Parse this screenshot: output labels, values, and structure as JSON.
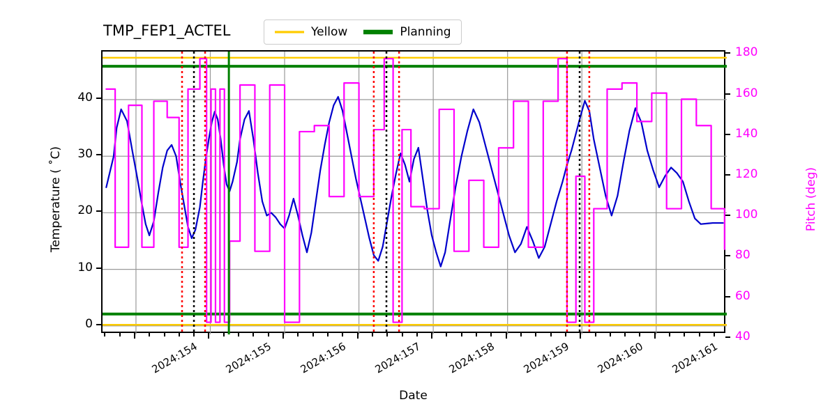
{
  "chart_data": {
    "type": "line",
    "title": "TMP_FEP1_ACTEL",
    "xlabel": "Date",
    "ylabel": "Temperature ( ˚C)",
    "y2label": "Pitch (deg)",
    "grid": true,
    "legend_position": "upper center",
    "xlim": [
      153.55,
      161.95
    ],
    "x_tick_labels": [
      "2024:154",
      "2024:155",
      "2024:156",
      "2024:157",
      "2024:158",
      "2024:159",
      "2024:160",
      "2024:161"
    ],
    "x_tick_values": [
      154,
      155,
      156,
      157,
      158,
      159,
      160,
      161
    ],
    "x_minor_per_major": 5,
    "ylim": [
      -1.5,
      48.5
    ],
    "y_ticks": [
      0,
      10,
      20,
      30,
      40
    ],
    "y2lim": [
      42.0,
      181.5
    ],
    "y2_ticks": [
      40,
      60,
      80,
      100,
      120,
      140,
      160,
      180
    ],
    "legend": [
      {
        "name": "Yellow",
        "color": "#FFCC00",
        "linewidth": 2
      },
      {
        "name": "Planning",
        "color": "#008000",
        "linewidth": 4
      }
    ],
    "series": [
      {
        "name": "Temperature",
        "color": "#0000CC",
        "axis": "left",
        "linewidth": 2.2,
        "x": [
          153.6,
          153.7,
          153.74,
          153.8,
          153.88,
          153.95,
          154.02,
          154.08,
          154.13,
          154.18,
          154.24,
          154.3,
          154.36,
          154.42,
          154.48,
          154.54,
          154.6,
          154.66,
          154.7,
          154.75,
          154.8,
          154.86,
          154.9,
          154.94,
          154.98,
          155.02,
          155.06,
          155.1,
          155.14,
          155.18,
          155.22,
          155.26,
          155.3,
          155.36,
          155.4,
          155.46,
          155.52,
          155.58,
          155.64,
          155.7,
          155.76,
          155.82,
          155.88,
          155.94,
          156.0,
          156.06,
          156.12,
          156.18,
          156.24,
          156.3,
          156.36,
          156.42,
          156.48,
          156.54,
          156.6,
          156.66,
          156.72,
          156.78,
          156.84,
          156.9,
          156.96,
          157.02,
          157.08,
          157.14,
          157.2,
          157.26,
          157.32,
          157.38,
          157.44,
          157.5,
          157.56,
          157.62,
          157.68,
          157.74,
          157.8,
          157.86,
          157.92,
          157.98,
          158.04,
          158.1,
          158.16,
          158.22,
          158.3,
          158.38,
          158.46,
          158.54,
          158.62,
          158.7,
          158.78,
          158.86,
          158.94,
          159.02,
          159.1,
          159.18,
          159.26,
          159.34,
          159.42,
          159.5,
          159.58,
          159.66,
          159.74,
          159.8,
          159.86,
          159.92,
          159.98,
          160.04,
          160.1,
          160.16,
          160.24,
          160.32,
          160.4,
          160.48,
          160.56,
          160.64,
          160.72,
          160.8,
          160.88,
          160.96,
          161.04,
          161.12,
          161.2,
          161.28,
          161.36,
          161.44,
          161.52,
          161.6,
          161.68,
          161.76,
          161.84,
          161.9
        ],
        "y": [
          24.5,
          30.0,
          35.0,
          38.3,
          36.2,
          31.0,
          26.0,
          21.5,
          18.0,
          16.0,
          18.5,
          23.5,
          28.0,
          31.0,
          32.0,
          30.0,
          25.0,
          20.5,
          17.5,
          15.5,
          17.0,
          21.0,
          25.5,
          29.5,
          33.0,
          36.0,
          37.9,
          36.5,
          33.0,
          28.5,
          25.0,
          23.8,
          25.5,
          29.0,
          33.0,
          36.5,
          38.0,
          33.0,
          27.0,
          22.0,
          19.5,
          20.0,
          19.2,
          18.0,
          17.2,
          19.5,
          22.5,
          19.5,
          16.0,
          13.0,
          16.5,
          22.0,
          27.5,
          32.0,
          36.0,
          39.0,
          40.5,
          38.0,
          34.0,
          30.0,
          26.0,
          22.5,
          19.0,
          15.5,
          12.5,
          11.5,
          14.0,
          18.5,
          23.0,
          27.0,
          30.5,
          28.5,
          25.5,
          29.5,
          31.5,
          26.0,
          20.5,
          16.0,
          13.0,
          10.5,
          13.0,
          18.0,
          24.5,
          30.0,
          34.5,
          38.3,
          36.0,
          32.0,
          28.0,
          24.0,
          20.0,
          16.0,
          13.0,
          14.5,
          17.5,
          15.0,
          12.0,
          14.0,
          18.0,
          22.0,
          25.5,
          28.5,
          31.0,
          34.0,
          37.0,
          39.8,
          38.0,
          33.0,
          28.0,
          23.0,
          19.5,
          23.0,
          29.0,
          34.5,
          38.5,
          36.0,
          31.0,
          27.5,
          24.5,
          26.5,
          28.0,
          27.0,
          25.5,
          22.0,
          19.0,
          18.0,
          18.1,
          18.2,
          18.2,
          18.2
        ]
      },
      {
        "name": "Pitch",
        "color": "#FF00FF",
        "axis": "right",
        "linewidth": 2.2,
        "drawstyle": "steps-post",
        "x": [
          153.6,
          153.66,
          153.72,
          153.8,
          153.9,
          154.0,
          154.08,
          154.16,
          154.24,
          154.33,
          154.42,
          154.5,
          154.58,
          154.64,
          154.7,
          154.78,
          154.86,
          154.92,
          154.95,
          154.98,
          155.01,
          155.04,
          155.07,
          155.1,
          155.13,
          155.16,
          155.19,
          155.22,
          155.26,
          155.32,
          155.4,
          155.5,
          155.6,
          155.7,
          155.8,
          155.9,
          156.0,
          156.1,
          156.2,
          156.3,
          156.4,
          156.5,
          156.6,
          156.7,
          156.8,
          156.9,
          157.0,
          157.1,
          157.2,
          157.28,
          157.34,
          157.4,
          157.46,
          157.52,
          157.58,
          157.64,
          157.7,
          157.78,
          157.88,
          157.98,
          158.08,
          158.18,
          158.28,
          158.38,
          158.48,
          158.58,
          158.68,
          158.78,
          158.88,
          158.98,
          159.08,
          159.18,
          159.28,
          159.38,
          159.48,
          159.58,
          159.68,
          159.74,
          159.8,
          159.86,
          159.92,
          159.98,
          160.04,
          160.1,
          160.16,
          160.24,
          160.34,
          160.44,
          160.54,
          160.64,
          160.74,
          160.84,
          160.94,
          161.04,
          161.14,
          161.24,
          161.34,
          161.44,
          161.54,
          161.64,
          161.74,
          161.84,
          161.92
        ],
        "y": [
          163,
          163,
          85,
          85,
          155,
          155,
          85,
          85,
          157,
          157,
          149,
          149,
          85,
          85,
          163,
          163,
          178,
          178,
          48,
          48,
          163,
          163,
          48,
          48,
          163,
          163,
          48,
          48,
          88,
          88,
          165,
          165,
          83,
          83,
          165,
          165,
          48,
          48,
          142,
          142,
          145,
          145,
          110,
          110,
          166,
          166,
          110,
          110,
          143,
          143,
          178,
          178,
          48,
          48,
          143,
          143,
          105,
          105,
          104,
          104,
          153,
          153,
          83,
          83,
          118,
          118,
          85,
          85,
          134,
          134,
          157,
          157,
          85,
          85,
          157,
          157,
          178,
          178,
          48,
          48,
          120,
          120,
          48,
          48,
          104,
          104,
          163,
          163,
          166,
          166,
          147,
          147,
          161,
          161,
          104,
          104,
          158,
          158,
          145,
          145,
          104,
          104,
          84
        ]
      }
    ],
    "hlines": [
      {
        "name": "yellow-upper",
        "color": "#FFCC00",
        "value_left_axis": 47.4,
        "linewidth": 2.5
      },
      {
        "name": "yellow-lower",
        "color": "#FFCC00",
        "value_left_axis": 0.2,
        "linewidth": 2.5
      },
      {
        "name": "planning-upper",
        "color": "#008000",
        "value_left_axis": 45.9,
        "linewidth": 4
      },
      {
        "name": "planning-lower",
        "color": "#008000",
        "value_left_axis": 2.1,
        "linewidth": 4
      }
    ],
    "vlines": [
      {
        "name": "red-dotted",
        "color": "#FF0000",
        "x": 154.62,
        "style": "dotted",
        "linewidth": 2.5
      },
      {
        "name": "black-dotted",
        "color": "#000000",
        "x": 154.78,
        "style": "dotted",
        "linewidth": 2.5
      },
      {
        "name": "red-dotted",
        "color": "#FF0000",
        "x": 154.93,
        "style": "dotted",
        "linewidth": 2.5
      },
      {
        "name": "green-solid",
        "color": "#008000",
        "x": 155.25,
        "style": "solid",
        "linewidth": 3
      },
      {
        "name": "red-dotted",
        "color": "#FF0000",
        "x": 157.2,
        "style": "dotted",
        "linewidth": 2.5
      },
      {
        "name": "black-dotted",
        "color": "#000000",
        "x": 157.37,
        "style": "dotted",
        "linewidth": 2.5
      },
      {
        "name": "red-dotted",
        "color": "#FF0000",
        "x": 157.54,
        "style": "dotted",
        "linewidth": 2.5
      },
      {
        "name": "red-dotted",
        "color": "#FF0000",
        "x": 159.8,
        "style": "dotted",
        "linewidth": 2.5
      },
      {
        "name": "black-dotted",
        "color": "#000000",
        "x": 159.97,
        "style": "dotted",
        "linewidth": 2.5
      },
      {
        "name": "red-dotted",
        "color": "#FF0000",
        "x": 160.1,
        "style": "dotted",
        "linewidth": 2.5
      }
    ]
  }
}
